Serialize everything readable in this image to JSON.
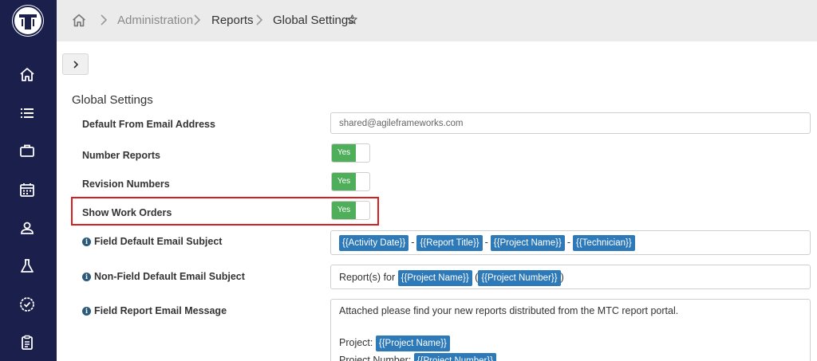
{
  "breadcrumb": {
    "items": [
      "Administration",
      "Reports",
      "Global Settings"
    ]
  },
  "sidebar": {
    "items": [
      "home-icon",
      "list-icon",
      "briefcase-icon",
      "calendar-icon",
      "user-icon",
      "flask-icon",
      "badge-check-icon",
      "clipboard-icon"
    ]
  },
  "page": {
    "section_title": "Global Settings"
  },
  "settings": {
    "default_from_label": "Default From Email Address",
    "default_from_value": "shared@agileframeworks.com",
    "number_reports_label": "Number Reports",
    "number_reports_value": "Yes",
    "revision_numbers_label": "Revision Numbers",
    "revision_numbers_value": "Yes",
    "show_work_orders_label": "Show Work Orders",
    "show_work_orders_value": "Yes",
    "field_subject_label": "Field Default Email Subject",
    "field_subject_tags": [
      "{{Activity Date}}",
      "{{Report Title}}",
      "{{Project Name}}",
      "{{Technician}}"
    ],
    "field_subject_sep": "-",
    "nonfield_subject_label": "Non-Field Default Email Subject",
    "nonfield_prefix": "Report(s) for",
    "nonfield_tag1": "{{Project Name}}",
    "nonfield_paren_open": "(",
    "nonfield_tag2": "{{Project Number}}",
    "nonfield_paren_close": ")",
    "message_label": "Field Report Email Message",
    "message_intro": "Attached please find your new reports distributed from the MTC report portal.",
    "message_project_label": "Project:",
    "message_project_tag": "{{Project Name}}",
    "message_number_label": "Project Number:",
    "message_number_tag": "{{Project Number}}"
  },
  "colors": {
    "sidebar": "#1a1f4b",
    "toggle_on": "#4fae5a",
    "tag": "#2e7ab8",
    "highlight": "#d81e1e"
  }
}
